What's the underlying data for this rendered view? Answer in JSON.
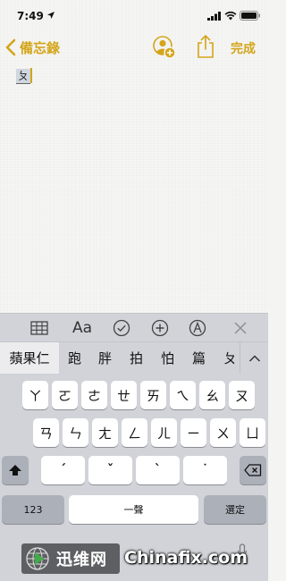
{
  "status_bar": {
    "time": "7:49"
  },
  "nav": {
    "back_label": "備忘錄",
    "done_label": "完成"
  },
  "note": {
    "text": "ㄆ"
  },
  "candidates": {
    "first": "蘋果仁",
    "items": [
      "跑",
      "胖",
      "拍",
      "怕",
      "篇",
      "ㄆ"
    ]
  },
  "keyboard": {
    "row1": [
      "ㄚ",
      "ㄛ",
      "ㄜ",
      "ㄝ",
      "ㄞ",
      "ㄟ",
      "ㄠ",
      "ㄡ"
    ],
    "row2": [
      "ㄢ",
      "ㄣ",
      "ㄤ",
      "ㄥ",
      "ㄦ",
      "ㄧ",
      "ㄨ",
      "ㄩ"
    ],
    "tones": [
      "ˊ",
      "ˇ",
      "ˋ",
      "˙"
    ],
    "numbers_label": "123",
    "space_label": "一聲",
    "select_label": "選定"
  },
  "watermark": {
    "cn": "迅维网",
    "en": "Chinafix.com"
  },
  "colors": {
    "accent": "#d4a51a",
    "keyboard_bg": "#d1d3d9",
    "paper": "#f5f5f3"
  }
}
